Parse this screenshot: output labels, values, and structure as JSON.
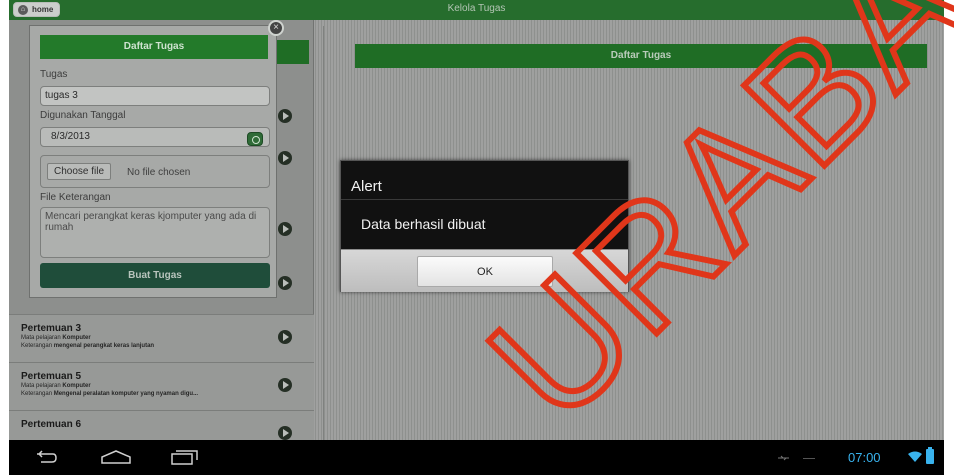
{
  "topbar": {
    "home_label": "home",
    "title": "Kelola Tugas"
  },
  "right_panel": {
    "header": "Daftar Tugas"
  },
  "form": {
    "header": "Daftar Tugas",
    "tugas_label": "Tugas",
    "tugas_value": "tugas 3",
    "date_label": "Digunakan Tanggal",
    "date_value": "8/3/2013",
    "choose_file_label": "Choose file",
    "no_file_text": "No file chosen",
    "keterangan_label": "File Keterangan",
    "keterangan_value": "Mencari perangkat keras kjomputer yang ada di rumah",
    "submit_label": "Buat Tugas"
  },
  "list": {
    "items": [
      {
        "title": "Pertemuan 3",
        "mapel_label": "Mata pelajaran",
        "mapel": "Komputer",
        "ket_label": "Keterangan",
        "ket": "mengenal perangkat keras lanjutan"
      },
      {
        "title": "Pertemuan 5",
        "mapel_label": "Mata pelajaran",
        "mapel": "Komputer",
        "ket_label": "Keterangan",
        "ket": "Mengenal peralatan komputer yang nyaman digu..."
      },
      {
        "title": "Pertemuan 6"
      }
    ]
  },
  "alert": {
    "title": "Alert",
    "message": "Data berhasil dibuat",
    "ok_label": "OK"
  },
  "status_bar": {
    "time": "07:00"
  },
  "watermark": {
    "text": "URABA"
  },
  "colors": {
    "accent_green": "#237a2a",
    "watermark": "#e0361a",
    "status_blue": "#39b3ee"
  },
  "icons": [
    "home-icon",
    "close-icon",
    "calendar-icon",
    "chevron-right-icon",
    "back-icon",
    "home-nav-icon",
    "recent-apps-icon",
    "usb-icon",
    "wifi-icon",
    "battery-icon"
  ]
}
